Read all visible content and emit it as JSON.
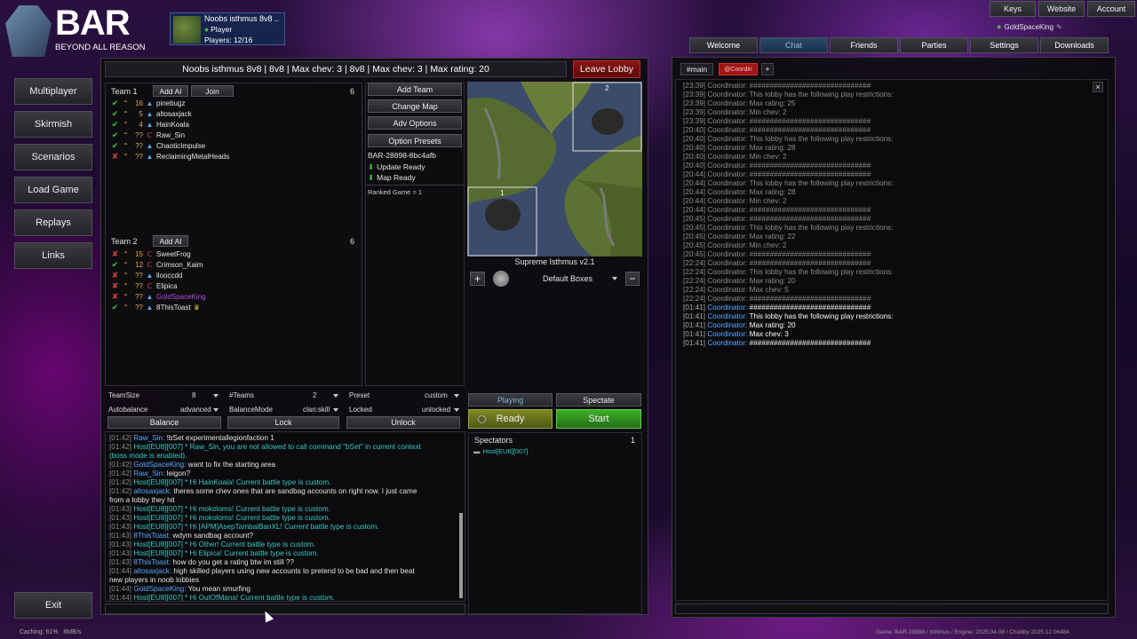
{
  "brand": {
    "name": "BAR",
    "tagline": "BEYOND ALL REASON"
  },
  "lobby_card": {
    "title": "Noobs isthmus 8v8 ..",
    "role": "Player",
    "players": "Players: 12/16"
  },
  "top_right": {
    "keys": "Keys",
    "website": "Website",
    "account": "Account",
    "user": "GoldSpaceKing"
  },
  "nav": [
    "Multiplayer",
    "Skirmish",
    "Scenarios",
    "Load Game",
    "Replays",
    "Links"
  ],
  "exit": "Exit",
  "lobby": {
    "title": "Noobs isthmus 8v8 | 8v8 | Max chev: 3 | 8v8 | Max chev: 3 | Max rating: 20",
    "leave": "Leave Lobby"
  },
  "team1": {
    "label": "Team 1",
    "add_ai": "Add AI",
    "join": "Join",
    "count": "6",
    "players": [
      {
        "s": "ok",
        "lvl": "16",
        "fac": "arm",
        "name": "pinebugz"
      },
      {
        "s": "ok",
        "lvl": "5",
        "fac": "arm",
        "name": "altosaxjack"
      },
      {
        "s": "ok",
        "lvl": "4",
        "fac": "arm",
        "name": "HainKoala"
      },
      {
        "s": "ok",
        "lvl": "??",
        "fac": "cor",
        "name": "Raw_Sin"
      },
      {
        "s": "ok",
        "lvl": "??",
        "fac": "arm",
        "name": "ChaoticImpulse"
      },
      {
        "s": "x",
        "lvl": "??",
        "fac": "arm",
        "name": "ReclaimingMetalHeads"
      }
    ]
  },
  "team2": {
    "label": "Team 2",
    "add_ai": "Add AI",
    "count": "6",
    "players": [
      {
        "s": "x",
        "lvl": "15",
        "fac": "cor",
        "name": "SweetFrog"
      },
      {
        "s": "ok",
        "lvl": "12",
        "fac": "cor",
        "name": "Crimson_Kaim"
      },
      {
        "s": "x",
        "lvl": "??",
        "fac": "arm",
        "name": "llooccdd"
      },
      {
        "s": "x",
        "lvl": "??",
        "fac": "cor",
        "name": "Elipica"
      },
      {
        "s": "x",
        "lvl": "??",
        "fac": "arm",
        "name": "GoldSpaceKing"
      },
      {
        "s": "ok",
        "lvl": "??",
        "fac": "arm",
        "name": "8ThisToast"
      }
    ]
  },
  "actions": {
    "add_team": "Add Team",
    "change_map": "Change Map",
    "adv_options": "Adv Options",
    "option_presets": "Option Presets"
  },
  "battle": {
    "id": "BAR-28898-8bc4afb",
    "update": "Update Ready",
    "map": "Map Ready",
    "ranked": "Ranked Game = 1"
  },
  "map": {
    "name": "Supreme Isthmus v2.1",
    "box_label": "Default Boxes",
    "box1": "1",
    "box2": "2"
  },
  "settings": {
    "teamsize_label": "TeamSize",
    "teamsize": "8",
    "teams_label": "#Teams",
    "teams": "2",
    "preset_label": "Preset",
    "preset": "custom",
    "autobalance_label": "Autobalance",
    "autobalance": "advanced",
    "balancemode_label": "BalanceMode",
    "balancemode": "clan:skill",
    "locked_label": "Locked",
    "locked": "unlocked"
  },
  "buttons": {
    "balance": "Balance",
    "lock": "Lock",
    "unlock": "Unlock",
    "playing": "Playing",
    "spectate": "Spectate",
    "ready": "Ready",
    "start": "Start"
  },
  "spectators": {
    "label": "Spectators",
    "count": "1",
    "list": [
      "Host[EU8][007]"
    ]
  },
  "chat": [
    {
      "ts": "[01:42]",
      "user": "Raw_Sin:",
      "msg": "!bSet experimentallegionfaction 1",
      "c": "usr"
    },
    {
      "ts": "[01:42]",
      "user": "Host[EU8][007]",
      "msg": "* Raw_Sin, you are not allowed to call command \"bSet\" in current context",
      "c": "host"
    },
    {
      "ts": "",
      "user": "",
      "msg": "(boss mode is enabled).",
      "c": "host"
    },
    {
      "ts": "[01:42]",
      "user": "GoldSpaceKing:",
      "msg": "want to fix the starting area",
      "c": "usr"
    },
    {
      "ts": "[01:42]",
      "user": "Raw_Sin:",
      "msg": "leigon?",
      "c": "usr"
    },
    {
      "ts": "[01:42]",
      "user": "Host[EU8][007]",
      "msg": "* Hi HainKoala! Current battle type is custom.",
      "c": "host"
    },
    {
      "ts": "[01:42]",
      "user": "altosaxjack:",
      "msg": "theres some chev ones that are sandbag accounts on right now. I just came",
      "c": "usr"
    },
    {
      "ts": "",
      "user": "",
      "msg": "from a lobby they hit",
      "c": "plain"
    },
    {
      "ts": "[01:43]",
      "user": "Host[EU8][007]",
      "msg": "* Hi mokoloms! Current battle type is custom.",
      "c": "host"
    },
    {
      "ts": "[01:43]",
      "user": "Host[EU8][007]",
      "msg": "* Hi mokoloms! Current battle type is custom.",
      "c": "host"
    },
    {
      "ts": "[01:43]",
      "user": "Host[EU8][007]",
      "msg": "* Hi [APM]AsepTambalBanXL! Current battle type is custom.",
      "c": "host"
    },
    {
      "ts": "[01:43]",
      "user": "8ThisToast:",
      "msg": "wdym sandbag account?",
      "c": "usr"
    },
    {
      "ts": "[01:43]",
      "user": "Host[EU8][007]",
      "msg": "* Hi Other! Current battle type is custom.",
      "c": "host"
    },
    {
      "ts": "[01:43]",
      "user": "Host[EU8][007]",
      "msg": "* Hi Elipica! Current battle type is custom.",
      "c": "host"
    },
    {
      "ts": "[01:43]",
      "user": "8ThisToast:",
      "msg": "how do you get a rating btw im still ??",
      "c": "usr"
    },
    {
      "ts": "[01:44]",
      "user": "altosaxjack:",
      "msg": "high skilled players using new accounts to pretend to be bad and then beat",
      "c": "usr"
    },
    {
      "ts": "",
      "user": "",
      "msg": "new players in noob lobbies",
      "c": "plain"
    },
    {
      "ts": "[01:44]",
      "user": "GoldSpaceKing:",
      "msg": "You mean smurfing",
      "c": "usr"
    },
    {
      "ts": "[01:44]",
      "user": "Host[EU8][007]",
      "msg": "* Hi OutOfMana! Current battle type is custom.",
      "c": "host"
    }
  ],
  "right_tabs": [
    "Welcome",
    "Chat",
    "Friends",
    "Parties",
    "Settings",
    "Downloads"
  ],
  "channel_tabs": {
    "main": "#main",
    "coord": "@Coordin",
    "add": "+"
  },
  "close_x": "×",
  "coord_log": [
    {
      "ts": "[23:39]",
      "n": "Coordinator:",
      "m": "##############################",
      "b": false
    },
    {
      "ts": "[23:39]",
      "n": "Coordinator:",
      "m": "This lobby has the following play restrictions:",
      "b": false
    },
    {
      "ts": "[23:39]",
      "n": "Coordinator:",
      "m": "Max rating: 25",
      "b": false
    },
    {
      "ts": "[23:39]",
      "n": "Coordinator:",
      "m": "Min chev: 2",
      "b": false
    },
    {
      "ts": "[23:39]",
      "n": "Coordinator:",
      "m": "##############################",
      "b": false
    },
    {
      "ts": "[20:40]",
      "n": "Coordinator:",
      "m": "##############################",
      "b": false
    },
    {
      "ts": "[20:40]",
      "n": "Coordinator:",
      "m": "This lobby has the following play restrictions:",
      "b": false
    },
    {
      "ts": "[20:40]",
      "n": "Coordinator:",
      "m": "Max rating: 28",
      "b": false
    },
    {
      "ts": "[20:40]",
      "n": "Coordinator:",
      "m": "Min chev: 2",
      "b": false
    },
    {
      "ts": "[20:40]",
      "n": "Coordinator:",
      "m": "##############################",
      "b": false
    },
    {
      "ts": "[20:44]",
      "n": "Coordinator:",
      "m": "##############################",
      "b": false
    },
    {
      "ts": "[20:44]",
      "n": "Coordinator:",
      "m": "This lobby has the following play restrictions:",
      "b": false
    },
    {
      "ts": "[20:44]",
      "n": "Coordinator:",
      "m": "Max rating: 28",
      "b": false
    },
    {
      "ts": "[20:44]",
      "n": "Coordinator:",
      "m": "Min chev: 2",
      "b": false
    },
    {
      "ts": "[20:44]",
      "n": "Coordinator:",
      "m": "##############################",
      "b": false
    },
    {
      "ts": "[20:45]",
      "n": "Coordinator:",
      "m": "##############################",
      "b": false
    },
    {
      "ts": "[20:45]",
      "n": "Coordinator:",
      "m": "This lobby has the following play restrictions:",
      "b": false
    },
    {
      "ts": "[20:45]",
      "n": "Coordinator:",
      "m": "Max rating: 22",
      "b": false
    },
    {
      "ts": "[20:45]",
      "n": "Coordinator:",
      "m": "Min chev: 2",
      "b": false
    },
    {
      "ts": "[20:45]",
      "n": "Coordinator:",
      "m": "##############################",
      "b": false
    },
    {
      "ts": "[22:24]",
      "n": "Coordinator:",
      "m": "##############################",
      "b": false
    },
    {
      "ts": "[22:24]",
      "n": "Coordinator:",
      "m": "This lobby has the following play restrictions:",
      "b": false
    },
    {
      "ts": "[22:24]",
      "n": "Coordinator:",
      "m": "Max rating: 20",
      "b": false
    },
    {
      "ts": "[22:24]",
      "n": "Coordinator:",
      "m": "Max chev: 5",
      "b": false
    },
    {
      "ts": "[22:24]",
      "n": "Coordinator:",
      "m": "##############################",
      "b": false
    },
    {
      "ts": "[01:41]",
      "n": "Coordinator:",
      "m": "##############################",
      "b": true
    },
    {
      "ts": "[01:41]",
      "n": "Coordinator:",
      "m": "This lobby has the following play restrictions:",
      "b": true
    },
    {
      "ts": "[01:41]",
      "n": "Coordinator:",
      "m": "Max rating: 20",
      "b": true
    },
    {
      "ts": "[01:41]",
      "n": "Coordinator:",
      "m": "Max chev: 3",
      "b": true
    },
    {
      "ts": "[01:41]",
      "n": "Coordinator:",
      "m": "##############################",
      "b": true
    }
  ],
  "status": {
    "left": "Caching: 61%   8MB/s",
    "right": "Game: BAR-28898 / Isthmus / Engine: 2025.04.08 / Chobby 2025.12.06484"
  }
}
